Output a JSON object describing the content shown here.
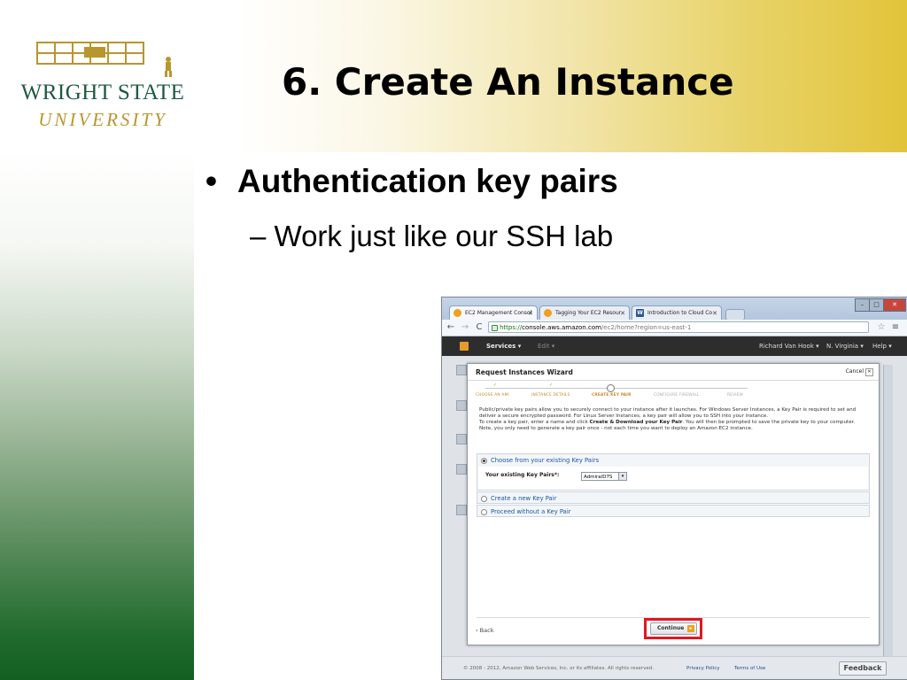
{
  "slide": {
    "title": "6. Create An Instance",
    "bullet": "Authentication key pairs",
    "bullet_marker": "•",
    "sub_bullet": "– Work just like our SSH lab",
    "logo": {
      "line1": "WRIGHT STATE",
      "line2": "UNIVERSITY"
    },
    "colors": {
      "green": "#1d5a3e",
      "gold": "#b8962e",
      "header_gold": "#e2c43a",
      "highlight_red": "#e0181e"
    }
  },
  "browser": {
    "tabs": [
      {
        "label": "EC2 Management Consol",
        "icon": "aws-favicon-icon",
        "active": true
      },
      {
        "label": "Tagging Your EC2 Resour",
        "icon": "aws-favicon-icon",
        "active": false
      },
      {
        "label": "Introduction to Cloud Co",
        "icon": "word-favicon-icon",
        "active": false
      }
    ],
    "url": {
      "scheme": "https://",
      "host": "console.aws.amazon.com",
      "path": "/ec2/home?region=us-east-1"
    },
    "aws_nav": {
      "services": "Services",
      "edit": "Edit",
      "user": "Richard Van Hook",
      "region": "N. Virginia",
      "help": "Help"
    },
    "wizard": {
      "title": "Request Instances Wizard",
      "cancel": "Cancel",
      "steps": [
        {
          "label": "CHOOSE AN AMI",
          "state": "done"
        },
        {
          "label": "INSTANCE DETAILS",
          "state": "done"
        },
        {
          "label": "CREATE KEY PAIR",
          "state": "current"
        },
        {
          "label": "CONFIGURE FIREWALL",
          "state": "todo"
        },
        {
          "label": "REVIEW",
          "state": "todo"
        }
      ],
      "description_1": "Public/private key pairs allow you to securely connect to your instance after it launches. For Windows Server Instances, a Key Pair is required to set and deliver a secure encrypted password. For Linux Server Instances, a key pair will allow you to SSH into your instance.",
      "description_2a": "To create a key pair, enter a name and click ",
      "description_2b": "Create & Download your Key Pair",
      "description_2c": ". You will then be prompted to save the private key to your computer. Note, you only need to generate a key pair once - not each time you want to deploy an Amazon EC2 instance.",
      "options": [
        {
          "label": "Choose from your existing Key Pairs",
          "selected": true
        },
        {
          "label": "Create a new Key Pair",
          "selected": false
        },
        {
          "label": "Proceed without a Key Pair",
          "selected": false
        }
      ],
      "existing_label": "Your existing Key Pairs*:",
      "existing_value": "AdmiralD7S",
      "back": "Back",
      "continue": "Continue"
    },
    "footer": {
      "copyright": "© 2008 - 2012, Amazon Web Services, Inc. or its affiliates. All rights reserved.",
      "privacy": "Privacy Policy",
      "terms": "Terms of Use",
      "feedback": "Feedback"
    }
  }
}
